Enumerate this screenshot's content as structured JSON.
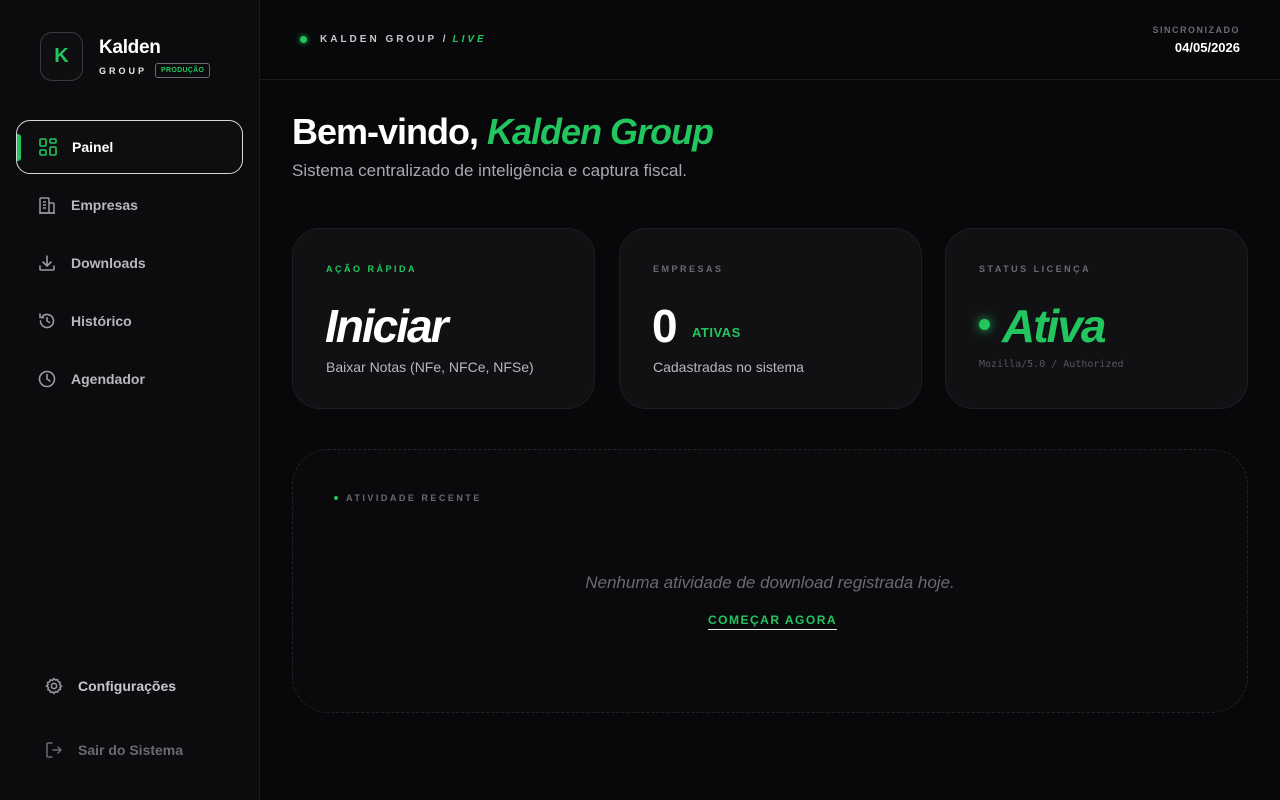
{
  "brand": {
    "logo_letter": "K",
    "name": "Kalden",
    "group": "GROUP",
    "badge": "PRODUÇÃO"
  },
  "sidebar": {
    "items": [
      {
        "label": "Painel",
        "icon": "grid-icon",
        "active": true
      },
      {
        "label": "Empresas",
        "icon": "building-icon",
        "active": false
      },
      {
        "label": "Downloads",
        "icon": "download-icon",
        "active": false
      },
      {
        "label": "Histórico",
        "icon": "history-icon",
        "active": false
      },
      {
        "label": "Agendador",
        "icon": "clock-icon",
        "active": false
      }
    ],
    "settings_label": "Configurações",
    "logout_label": "Sair do Sistema"
  },
  "header": {
    "org": "KALDEN GROUP /",
    "live_tag": "LIVE",
    "sync_label": "SINCRONIZADO",
    "sync_date": "04/05/2026"
  },
  "welcome": {
    "greeting": "Bem-vindo,",
    "name": "Kalden Group",
    "subtitle": "Sistema centralizado de inteligência e captura fiscal."
  },
  "cards": {
    "quick_action": {
      "label": "AÇÃO RÁPIDA",
      "title": "Iniciar",
      "desc": "Baixar Notas (NFe, NFCe, NFSe)"
    },
    "companies": {
      "label": "EMPRESAS",
      "count": "0",
      "unit": "ATIVAS",
      "desc": "Cadastradas no sistema"
    },
    "license": {
      "label": "STATUS LICENÇA",
      "status": "Ativa",
      "user_agent": "Mozilla/5.0 / Authorized"
    }
  },
  "activity": {
    "label": "ATIVIDADE RECENTE",
    "empty": "Nenhuma atividade de download registrada hoje.",
    "cta": "COMEÇAR AGORA"
  },
  "colors": {
    "accent": "#22c55e",
    "background": "#08080a",
    "sidebar": "#0c0c0e",
    "card": "#111114"
  }
}
